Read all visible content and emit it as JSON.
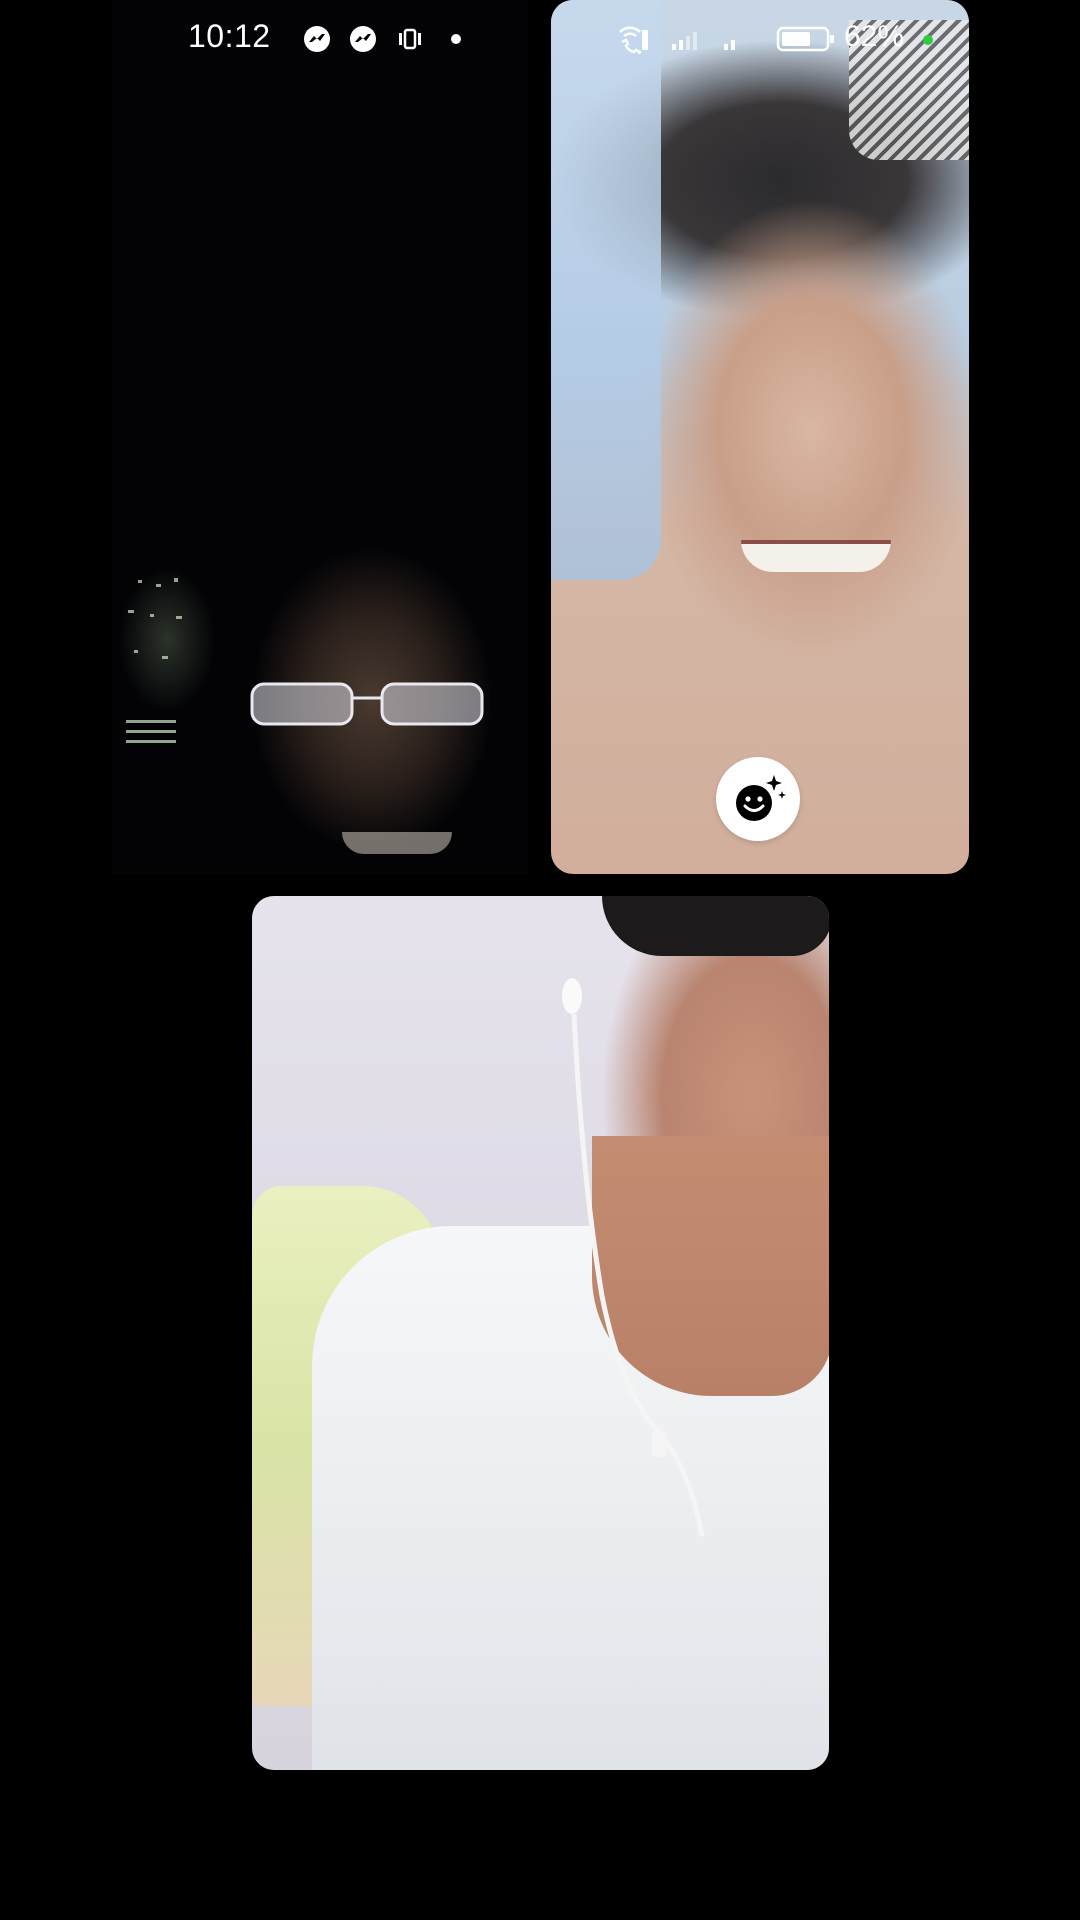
{
  "status_bar": {
    "time": "10:12",
    "left_icons": [
      "messenger-icon",
      "messenger-icon",
      "vibrate-icon",
      "notification-dot-icon"
    ],
    "right_icons": [
      "wifi-calling-icon",
      "signal-icon",
      "signal-icon",
      "battery-icon"
    ],
    "battery_percent": "62%",
    "charging_color": "#2ecc40"
  },
  "call": {
    "participants": [
      {
        "tile": "top-left",
        "brightness": "dark"
      },
      {
        "tile": "top-right",
        "brightness": "bright"
      },
      {
        "tile": "bottom",
        "brightness": "bright"
      }
    ],
    "effects_button_icon": "smiley-sparkle-icon"
  }
}
